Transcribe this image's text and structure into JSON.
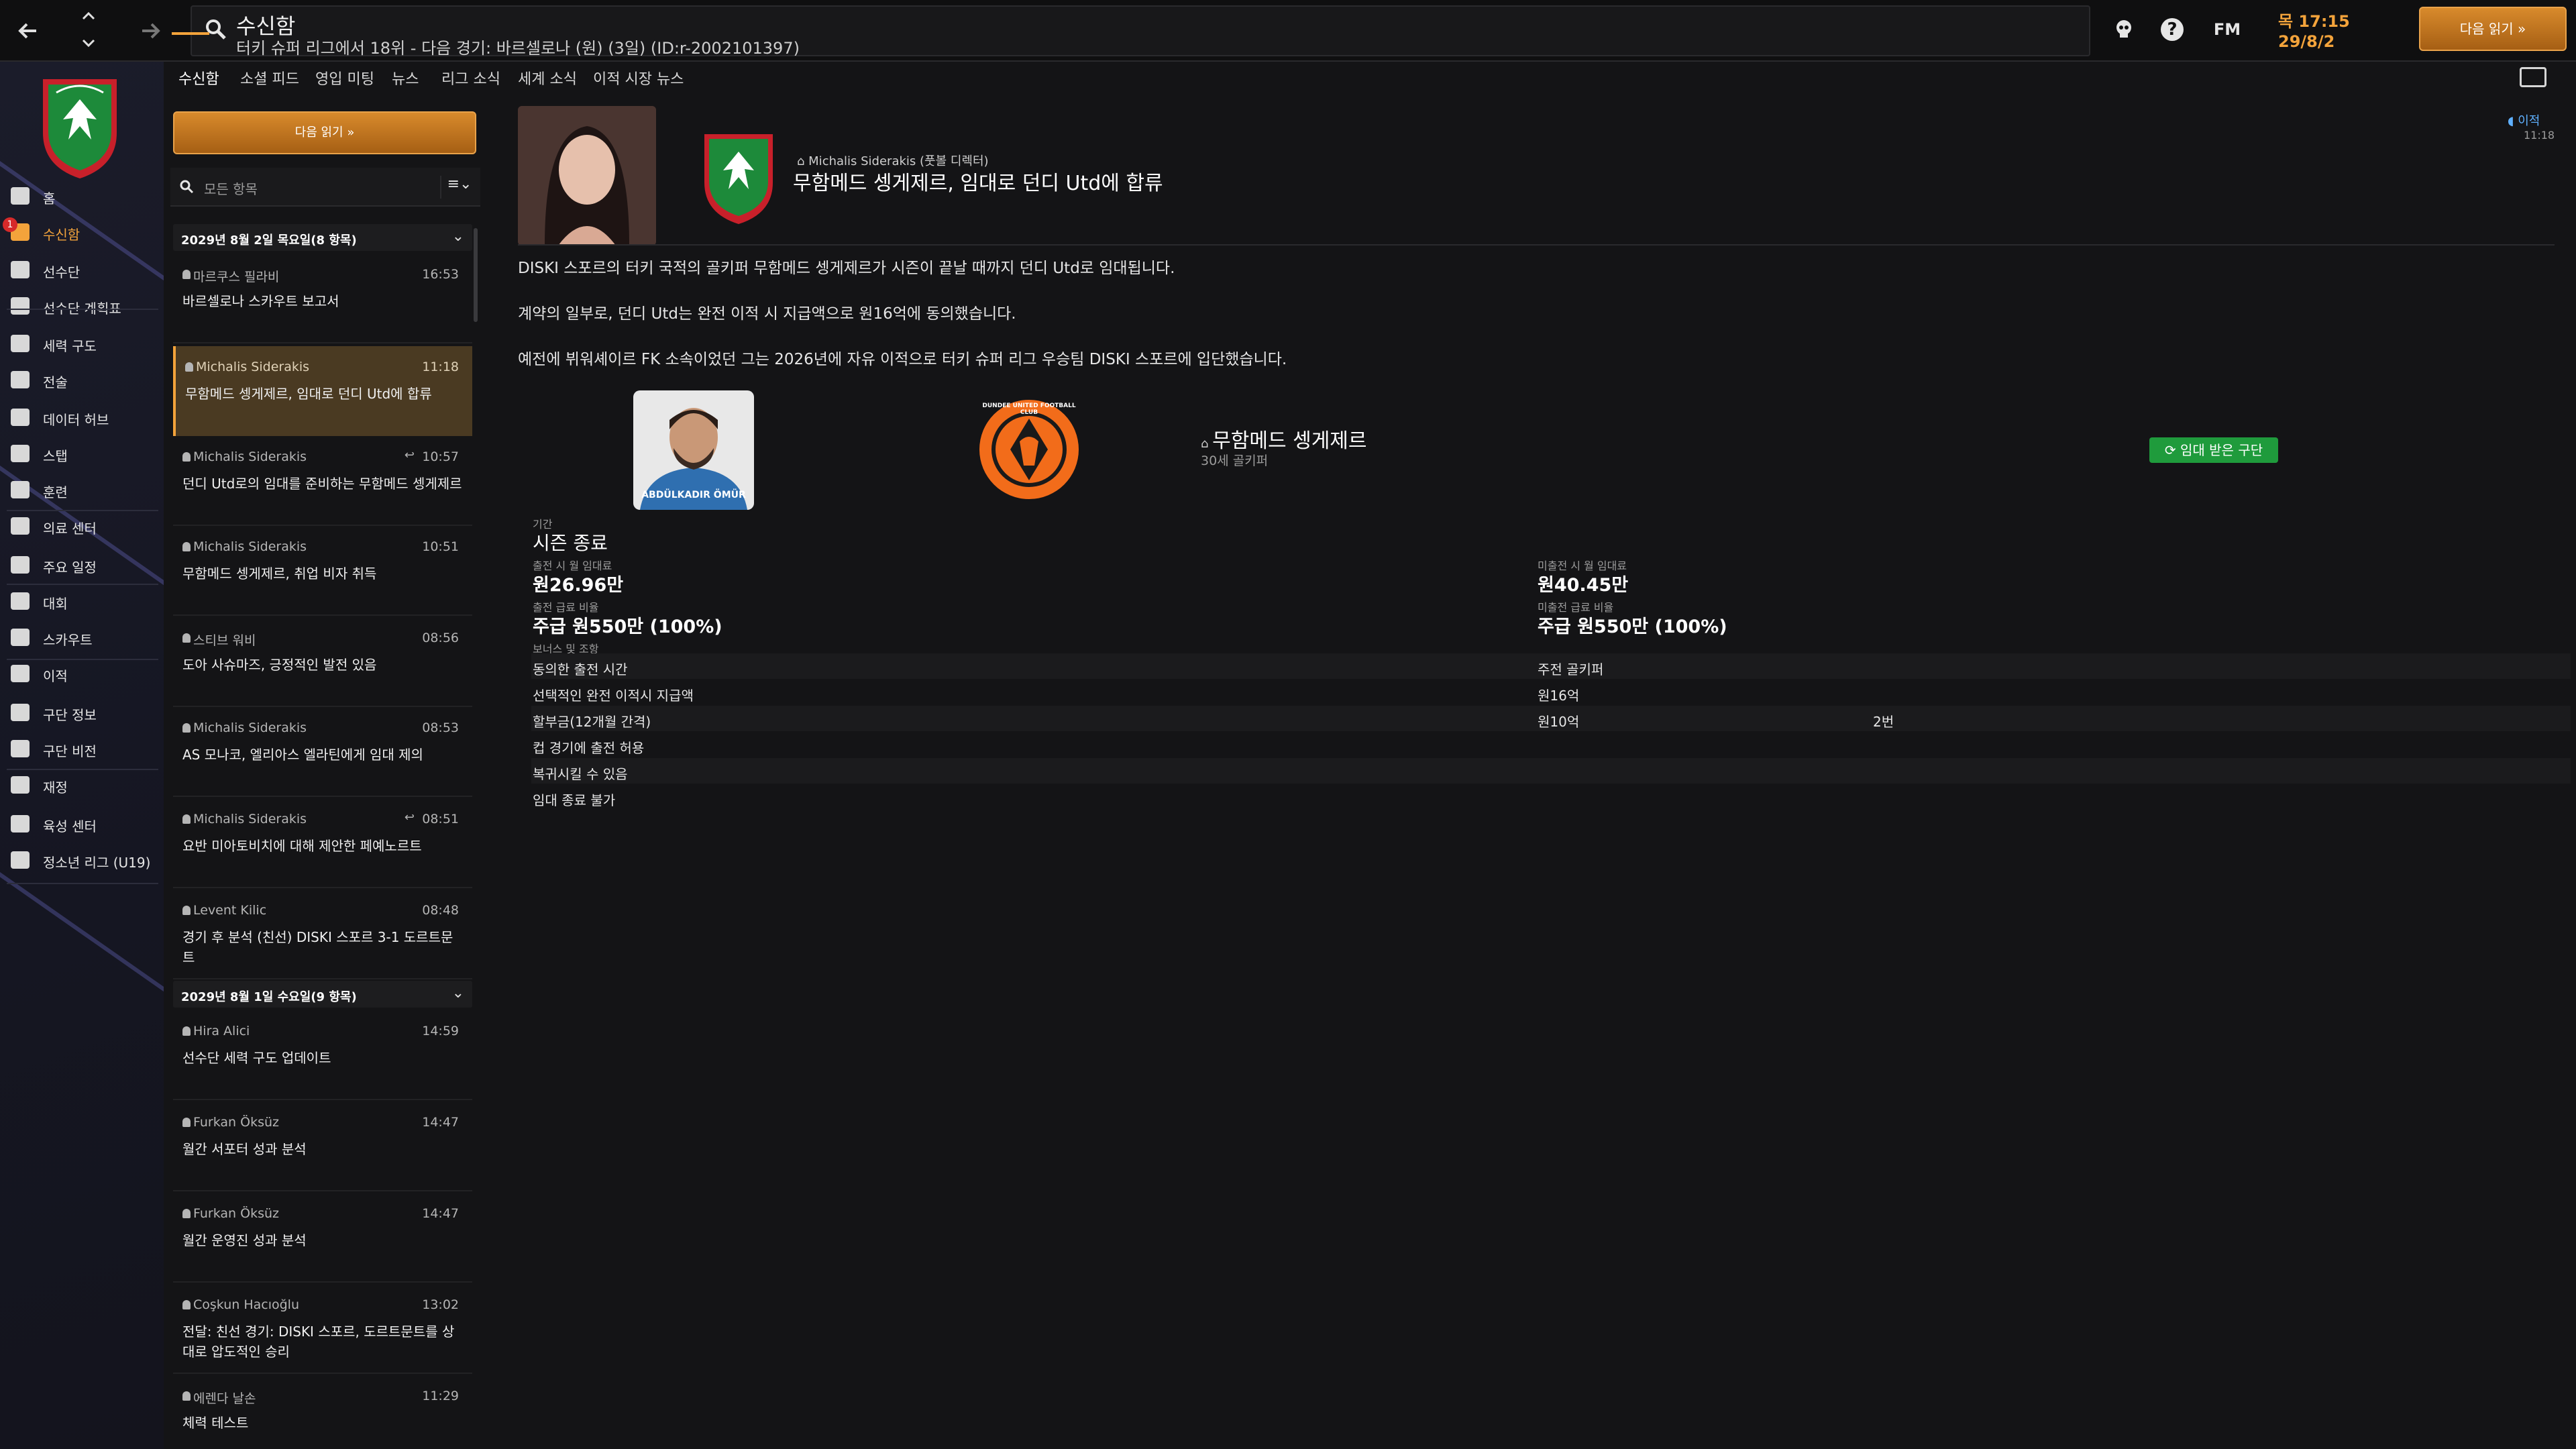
{
  "header": {
    "title": "수신함",
    "subtitle": "터키 슈퍼 리그에서 18위 - 다음 경기: 바르셀로나 (원) (3일) (ID:r-2002101397)",
    "fm_logo": "FM",
    "date_line1": "목 17:15",
    "date_line2": "29/8/2",
    "continue_label": "다음 읽기"
  },
  "sidebar": {
    "badge_count": "1",
    "items": [
      {
        "label": "홈",
        "icon": "home-icon"
      },
      {
        "label": "수신함",
        "icon": "inbox-icon",
        "active": true
      },
      {
        "label": "선수단",
        "icon": "shirt-icon"
      },
      {
        "label": "선수단 계획표",
        "icon": "clipboard-icon"
      },
      {
        "label": "세력 구도",
        "icon": "network-icon"
      },
      {
        "label": "전술",
        "icon": "tactics-icon"
      },
      {
        "label": "데이터 허브",
        "icon": "data-icon"
      },
      {
        "label": "스탭",
        "icon": "staff-icon"
      },
      {
        "label": "훈련",
        "icon": "training-icon"
      },
      {
        "label": "의료 센터",
        "icon": "medical-icon"
      },
      {
        "label": "주요 일정",
        "icon": "calendar-icon"
      },
      {
        "label": "대회",
        "icon": "trophy-icon"
      },
      {
        "label": "스카우트",
        "icon": "scout-icon"
      },
      {
        "label": "이적",
        "icon": "transfer-icon"
      },
      {
        "label": "구단 정보",
        "icon": "club-icon"
      },
      {
        "label": "구단 비전",
        "icon": "vision-icon"
      },
      {
        "label": "재정",
        "icon": "finance-icon"
      },
      {
        "label": "육성 센터",
        "icon": "development-icon"
      },
      {
        "label": "정소년 리그 (U19)",
        "icon": "youth-icon"
      }
    ]
  },
  "tabs": [
    "수신함",
    "소셜 피드",
    "영입 미팅",
    "뉴스",
    "리그 소식",
    "세계 소식",
    "이적 시장 뉴스"
  ],
  "list": {
    "continue_label": "다음 읽기",
    "filter_placeholder": "모든 항목",
    "groups": [
      {
        "header": "2029년 8월 2일 목요일(8 항목)"
      },
      {
        "header": "2029년 8월 1일 수요일(9 항목)"
      }
    ],
    "messages": [
      {
        "sender": "마르쿠스 필라비",
        "time": "16:53",
        "subject": "바르셀로나 스카우트 보고서",
        "reply": false
      },
      {
        "sender": "Michalis Siderakis",
        "time": "11:18",
        "subject": "무함메드 셍게제르, 임대로 던디 Utd에 합류",
        "reply": false,
        "selected": true
      },
      {
        "sender": "Michalis Siderakis",
        "time": "10:57",
        "subject": "던디 Utd로의 임대를 준비하는 무함메드 셍게제르",
        "reply": true
      },
      {
        "sender": "Michalis Siderakis",
        "time": "10:51",
        "subject": "무함메드 셍게제르, 취업 비자 취득",
        "reply": false
      },
      {
        "sender": "스티브 워비",
        "time": "08:56",
        "subject": "도아 사슈마즈, 긍정적인 발전 있음",
        "reply": false
      },
      {
        "sender": "Michalis Siderakis",
        "time": "08:53",
        "subject": "AS 모나코, 엘리아스 엘라틴에게 임대 제의",
        "reply": false
      },
      {
        "sender": "Michalis Siderakis",
        "time": "08:51",
        "subject": "요반 미아토비치에 대해 제안한 페예노르트",
        "reply": true
      },
      {
        "sender": "Levent Kilic",
        "time": "08:48",
        "subject": "경기 후 분석 (친선) DISKI 스포르 3-1 도르트문트",
        "reply": false
      },
      {
        "sender": "Hira Alici",
        "time": "14:59",
        "subject": "선수단 세력 구도 업데이트",
        "reply": false
      },
      {
        "sender": "Furkan Öksüz",
        "time": "14:47",
        "subject": "월간 서포터 성과 분석",
        "reply": false
      },
      {
        "sender": "Furkan Öksüz",
        "time": "14:47",
        "subject": "월간 운영진 성과 분석",
        "reply": false
      },
      {
        "sender": "Coşkun Hacıoğlu",
        "time": "13:02",
        "subject": "전달: 친선 경기: DISKI 스포르, 도르트문트를 상대로 압도적인 승리",
        "reply": false
      },
      {
        "sender": "에렌다 날손",
        "time": "11:29",
        "subject": "체력 테스트",
        "reply": false
      }
    ]
  },
  "message": {
    "from": "Michalis Siderakis (풋볼 디렉터)",
    "title": "무함메드 셍게제르, 임대로 던디 Utd에 합류",
    "tag": "이적",
    "time": "11:18",
    "paragraphs": [
      "DISKI 스포르의 터키 국적의 골키퍼 무함메드 셍게제르가 시즌이 끝날 때까지 던디 Utd로 임대됩니다.",
      "계약의 일부로, 던디 Utd는 완전 이적 시 지급액으로 원16억에 동의했습니다.",
      "예전에 뷔워셰이르 FK 소속이었던 그는 2026년에 자유 이적으로 터키 슈퍼 리그 우승팀 DISKI 스포르에 입단했습니다."
    ],
    "player_name": "무함메드 셍게제르",
    "player_sub": "30세 골키퍼",
    "player_shirt": "ABDÜLKADIR ÖMÜR",
    "loan_badge": "임대 받은 구단",
    "dundee_text": "DUNDEE UNITED FOOTBALL CLUB"
  },
  "details": {
    "period_label": "기간",
    "period_value": "시즌 종료",
    "fee_played_label": "출전 시 월 임대료",
    "fee_played_value": "원26.96만",
    "fee_unused_label": "미출전 시 월 임대료",
    "fee_unused_value": "원40.45만",
    "wage_played_label": "출전 급료 비율",
    "wage_played_value": "주급 원550만 (100%)",
    "wage_unused_label": "미출전 급료 비율",
    "wage_unused_value": "주급 원550만 (100%)",
    "bonus_label": "보너스 및 조항",
    "rows": [
      {
        "c1": "동의한 출전 시간",
        "c2": "주전 골키퍼",
        "c3": ""
      },
      {
        "c1": "선택적인 완전 이적시 지급액",
        "c2": "원16억",
        "c3": ""
      },
      {
        "c1": "할부금(12개월 간격)",
        "c2": "원10억",
        "c3": "2번"
      },
      {
        "c1": "컵 경기에 출전 허용",
        "c2": "",
        "c3": ""
      },
      {
        "c1": "복귀시킬 수 있음",
        "c2": "",
        "c3": ""
      },
      {
        "c1": "임대 종료 불가",
        "c2": "",
        "c3": ""
      }
    ]
  },
  "colors": {
    "accent": "#f3a33b",
    "loan_green": "#1f9b3c",
    "crest_green": "#1d8a3a",
    "crest_red": "#c8202a",
    "dundee_orange": "#f26c1a"
  }
}
